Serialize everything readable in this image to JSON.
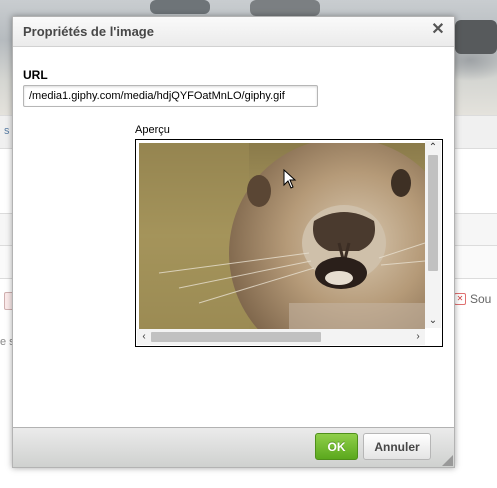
{
  "dialog": {
    "title": "Propriétés de l'image",
    "close_icon": "close-icon"
  },
  "form": {
    "url_label": "URL",
    "url_value": "/media1.giphy.com/media/hdjQYFOatMnLO/giphy.gif",
    "preview_label": "Aperçu"
  },
  "footer": {
    "ok_label": "OK",
    "cancel_label": "Annuler"
  },
  "background": {
    "left_link": "s",
    "left_text": "e s",
    "right_button_label": "Sou"
  },
  "colors": {
    "ok_button": "#6cb72b",
    "dialog_header": "#f3f3f3",
    "footer": "#dedede"
  }
}
